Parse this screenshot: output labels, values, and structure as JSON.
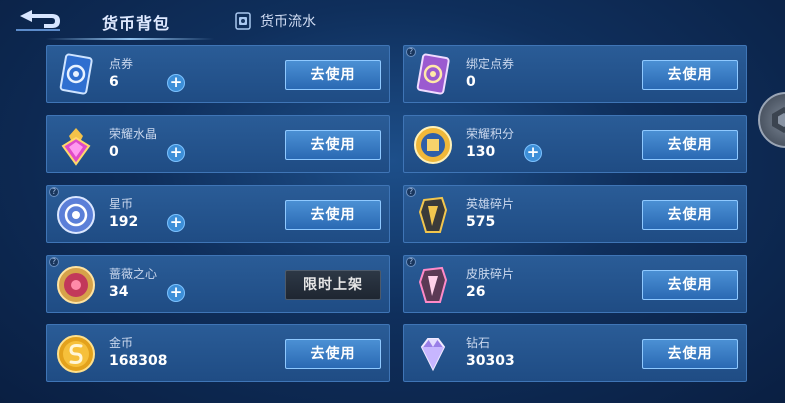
{
  "header": {
    "active_tab": "货币背包",
    "flow_tab": "货币流水"
  },
  "currencies": [
    {
      "name": "点券",
      "value": "6",
      "button": "去使用",
      "plus": true,
      "help": false,
      "icon": "voucher-card-icon"
    },
    {
      "name": "绑定点券",
      "value": "0",
      "button": "去使用",
      "plus": false,
      "help": true,
      "icon": "bound-voucher-card-icon"
    },
    {
      "name": "荣耀水晶",
      "value": "0",
      "button": "去使用",
      "plus": true,
      "help": false,
      "icon": "glory-crystal-icon"
    },
    {
      "name": "荣耀积分",
      "value": "130",
      "button": "去使用",
      "plus": true,
      "help": false,
      "icon": "glory-points-icon"
    },
    {
      "name": "星币",
      "value": "192",
      "button": "去使用",
      "plus": true,
      "help": true,
      "icon": "star-coin-icon"
    },
    {
      "name": "英雄碎片",
      "value": "575",
      "button": "去使用",
      "plus": false,
      "help": true,
      "icon": "hero-fragment-icon"
    },
    {
      "name": "蔷薇之心",
      "value": "34",
      "button": "限时上架",
      "plus": true,
      "help": true,
      "icon": "rose-heart-icon"
    },
    {
      "name": "皮肤碎片",
      "value": "26",
      "button": "去使用",
      "plus": false,
      "help": true,
      "icon": "skin-fragment-icon"
    },
    {
      "name": "金币",
      "value": "168308",
      "button": "去使用",
      "plus": false,
      "help": false,
      "icon": "gold-coin-icon"
    },
    {
      "name": "钻石",
      "value": "30303",
      "button": "去使用",
      "plus": false,
      "help": false,
      "icon": "diamond-icon"
    }
  ],
  "colors": {
    "card_bg": "#2a5c97",
    "button_blue": "#3b7fc8",
    "plus_blue": "#3d8fd8"
  }
}
